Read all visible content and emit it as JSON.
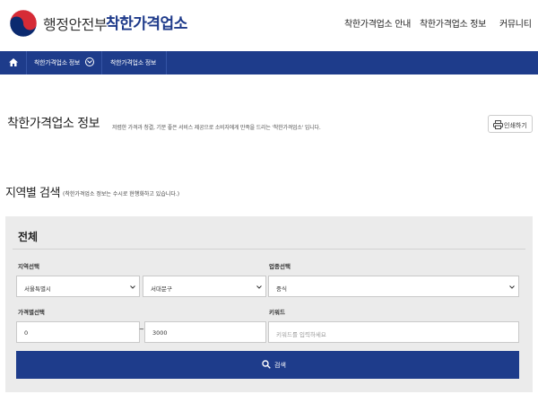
{
  "header": {
    "ministry_name": "행정안전부",
    "service_name": "착한가격업소",
    "logo_icon": "taegeuk-logo-icon",
    "brand_color": "#1e3a8a",
    "nav": [
      "착한가격업소 안내",
      "착한가격업소 정보",
      "커뮤니티"
    ]
  },
  "breadcrumb": {
    "home_icon": "home-icon",
    "items": [
      "착한가격업소 정보",
      "착한가격업소 정보"
    ],
    "bar_color": "#1e3c8b"
  },
  "page": {
    "title": "착한가격업소 정보",
    "description": "저렴한 가격과 청결, 기분 좋은 서비스 제공으로 소비자에게 만족을 드리는 '착한가격업소' 입니다.",
    "print_label": "인쇄하기"
  },
  "region_search": {
    "title": "지역별 검색",
    "note": "(착한가격업소 정보는 수시로 현행화하고 있습니다.)"
  },
  "search_panel": {
    "title": "전체",
    "labels": {
      "region": "지역선택",
      "business": "업종선택",
      "price": "가격별선택",
      "keyword": "키워드"
    },
    "region_city": "서울특별시",
    "region_district": "서대문구",
    "business_type": "중식",
    "price_min": "0",
    "price_separator": "~",
    "price_max": "3000",
    "keyword_placeholder": "키워드를 입력하세요",
    "search_label": "검색"
  }
}
